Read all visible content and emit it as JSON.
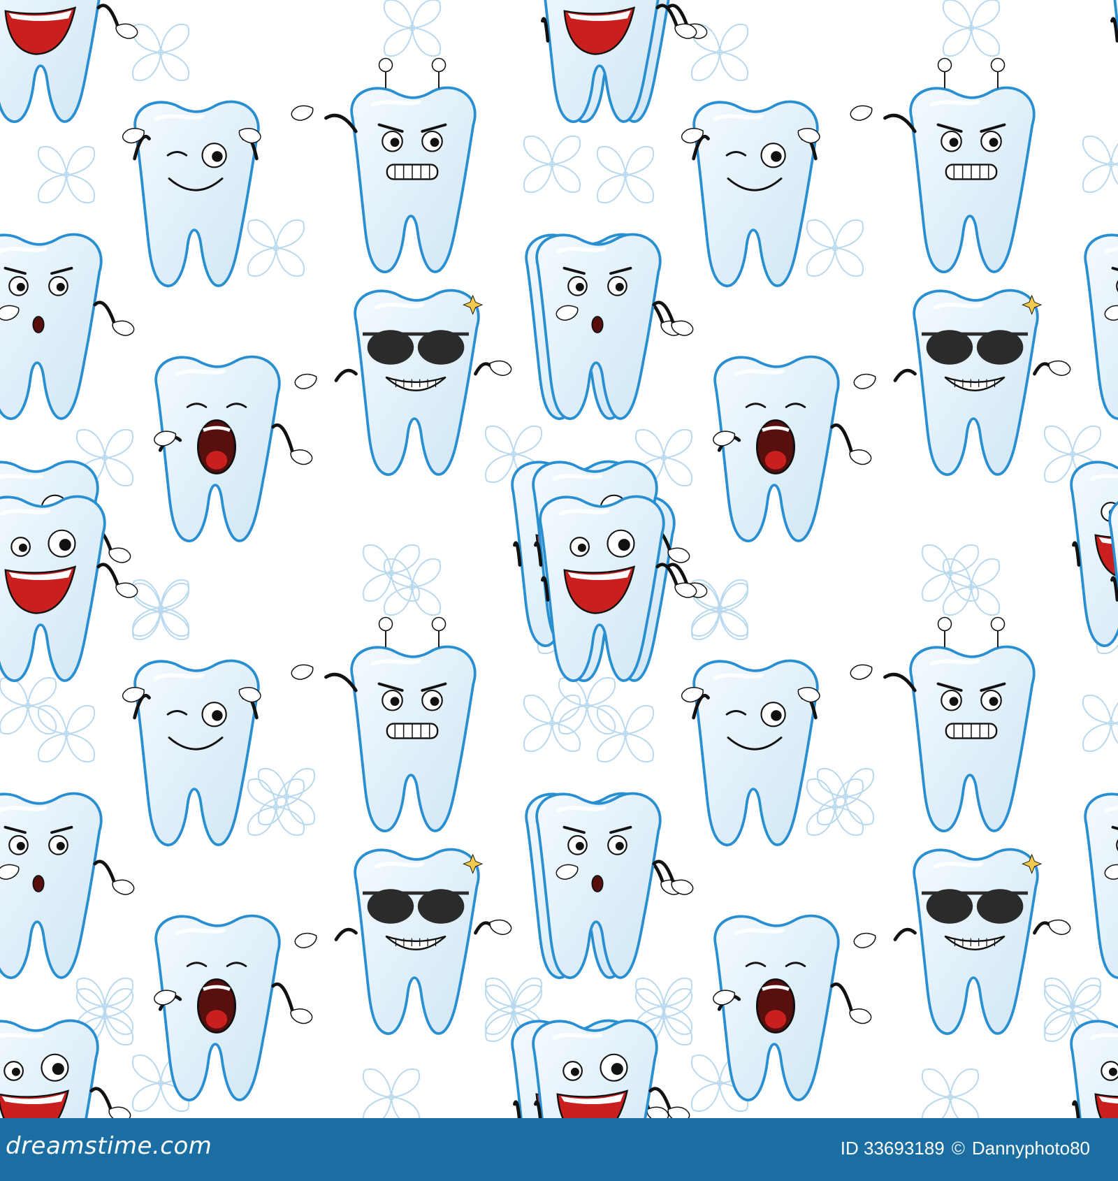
{
  "image": {
    "subject": "cartoon-tooth-pattern",
    "colors": {
      "background": "#ffffff",
      "tooth_fill": "#e7f3fb",
      "tooth_shade": "#cfe6f5",
      "tooth_outline": "#2a8fd1",
      "flower": "#b8d9ee",
      "face_ink": "#111111",
      "mouth_red": "#c9201f",
      "glasses": "#2b2b2b",
      "footer_bar": "#1b6ea1",
      "footer_text": "#ffffff"
    },
    "expressions": [
      "winking",
      "angry",
      "laughing",
      "cool-sunglasses",
      "yawning",
      "surprised"
    ]
  },
  "footer": {
    "logo": "dreamstime.com",
    "id_label": "ID 33693189",
    "copyright": "©",
    "author": "Dannyphoto80"
  }
}
